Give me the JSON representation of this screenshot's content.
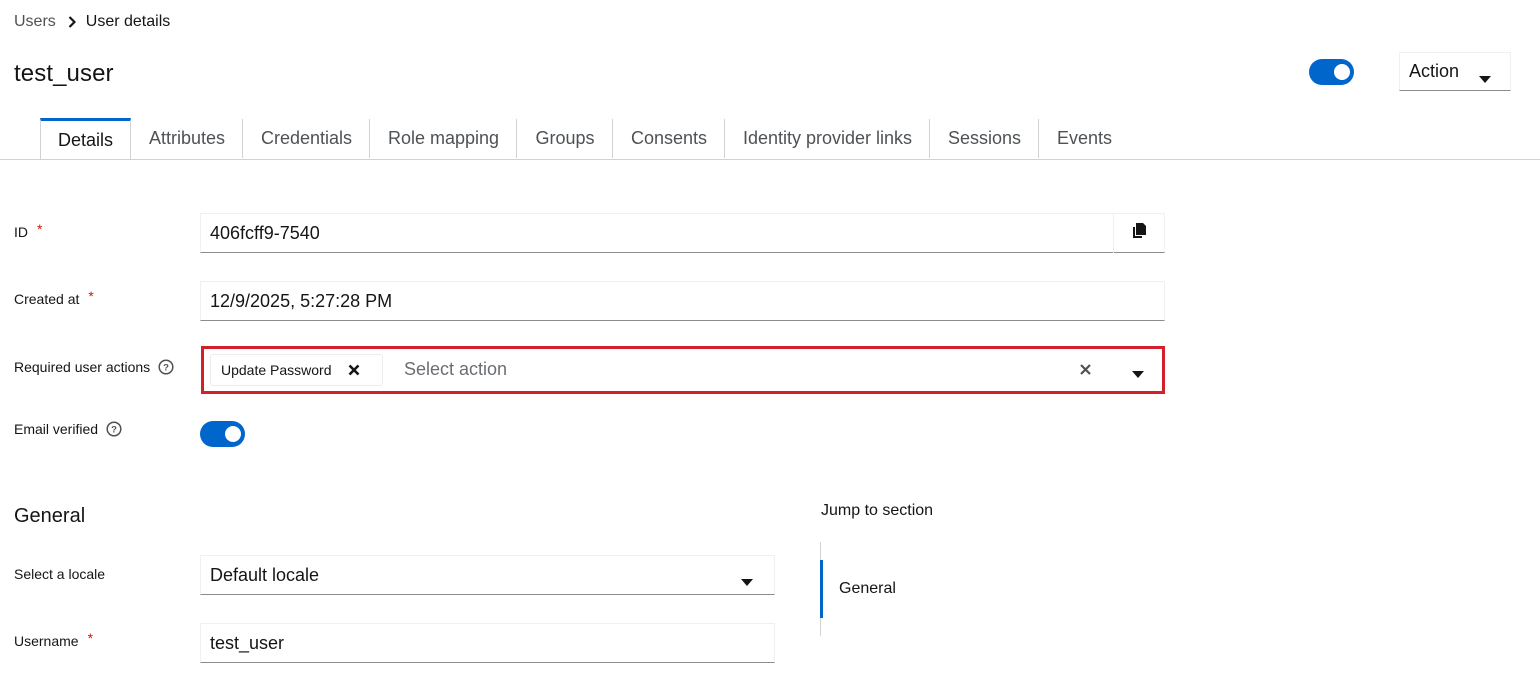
{
  "breadcrumb": {
    "users": "Users",
    "current": "User details"
  },
  "header": {
    "title": "test_user",
    "enabled": true,
    "action_label": "Action"
  },
  "tabs": [
    {
      "label": "Details",
      "active": true
    },
    {
      "label": "Attributes"
    },
    {
      "label": "Credentials"
    },
    {
      "label": "Role mapping"
    },
    {
      "label": "Groups"
    },
    {
      "label": "Consents"
    },
    {
      "label": "Identity provider links"
    },
    {
      "label": "Sessions"
    },
    {
      "label": "Events"
    }
  ],
  "form": {
    "id": {
      "label": "ID",
      "required_mark": "*",
      "value": "406fcff9-7540"
    },
    "created_at": {
      "label": "Created at",
      "required_mark": "*",
      "value": "12/9/2025, 5:27:28 PM"
    },
    "required_actions": {
      "label": "Required user actions",
      "chip": "Update Password",
      "placeholder": "Select action"
    },
    "email_verified": {
      "label": "Email verified",
      "value": true
    }
  },
  "general": {
    "heading": "General",
    "locale": {
      "label": "Select a locale",
      "value": "Default locale"
    },
    "username": {
      "label": "Username",
      "required_mark": "*",
      "value": "test_user"
    }
  },
  "jump": {
    "title": "Jump to section",
    "items": [
      "General"
    ]
  },
  "colors": {
    "accent": "#0066cc",
    "highlight": "#d3212c",
    "required": "#c9190b"
  },
  "icons": [
    "chevron-right-icon",
    "caret-down-icon",
    "copy-icon",
    "help-icon",
    "close-icon",
    "times-icon"
  ]
}
